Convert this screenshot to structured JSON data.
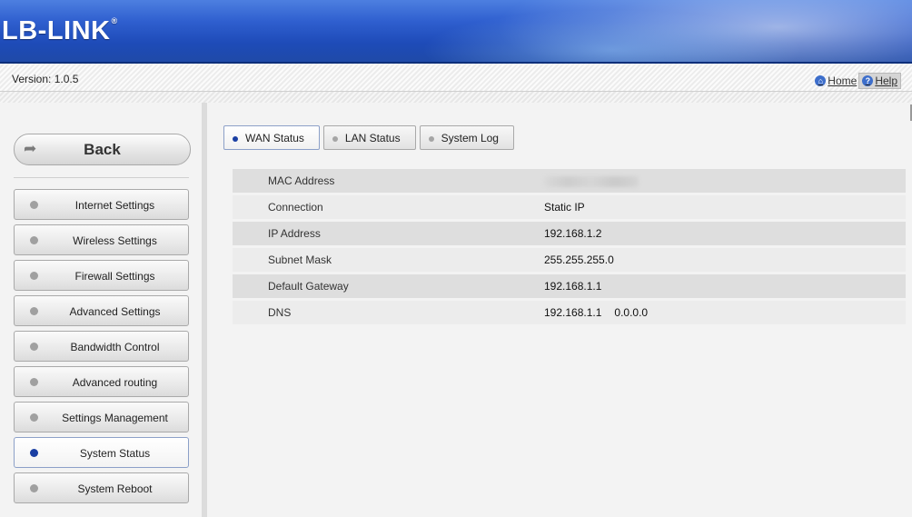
{
  "header": {
    "logo_text": "LB-LINK",
    "logo_mark": "®"
  },
  "topbar": {
    "version": "Version: 1.0.5",
    "home_label": "Home",
    "help_label": "Help"
  },
  "sidebar": {
    "back_label": "Back",
    "items": [
      {
        "label": "Internet Settings"
      },
      {
        "label": "Wireless Settings"
      },
      {
        "label": "Firewall Settings"
      },
      {
        "label": "Advanced Settings"
      },
      {
        "label": "Bandwidth Control"
      },
      {
        "label": "Advanced routing"
      },
      {
        "label": "Settings Management"
      },
      {
        "label": "System Status",
        "active": true
      },
      {
        "label": "System Reboot"
      }
    ]
  },
  "tabs": [
    {
      "label": "WAN Status",
      "active": true
    },
    {
      "label": "LAN Status"
    },
    {
      "label": "System Log"
    }
  ],
  "wan_status": {
    "rows": [
      {
        "label": "MAC Address",
        "value": ""
      },
      {
        "label": "Connection",
        "value": "Static IP"
      },
      {
        "label": "IP Address",
        "value": "192.168.1.2"
      },
      {
        "label": "Subnet Mask",
        "value": "255.255.255.0"
      },
      {
        "label": "Default Gateway",
        "value": "192.168.1.1"
      },
      {
        "label": "DNS",
        "value": "192.168.1.1",
        "value2": "0.0.0.0"
      }
    ]
  },
  "colors": {
    "banner_blue": "#1e4bb8",
    "active_dot": "#1a3fa3",
    "inactive_dot": "#a0a0a0"
  }
}
